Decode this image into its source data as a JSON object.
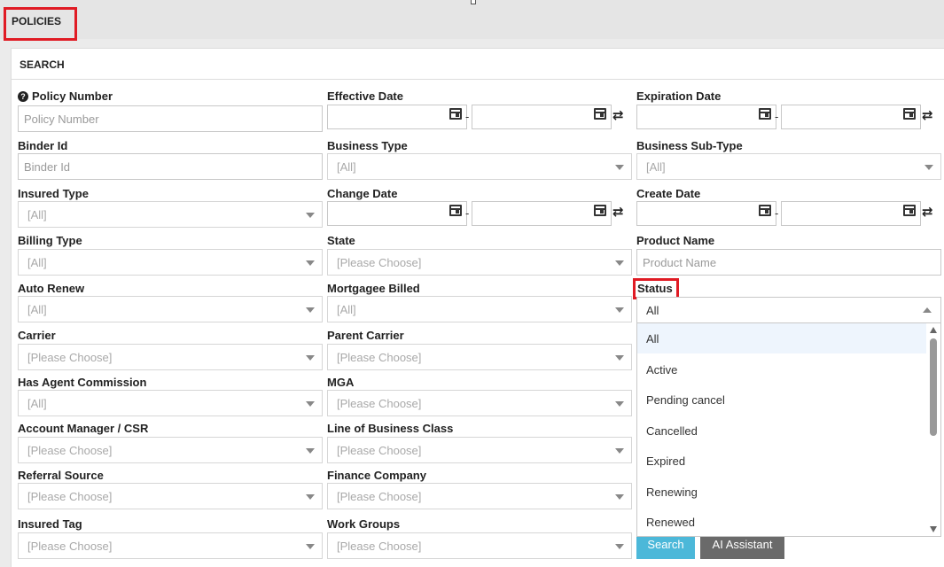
{
  "tab": {
    "title": "POLICIES"
  },
  "panel": {
    "header": "SEARCH"
  },
  "fields": {
    "policy_number": {
      "label": "Policy Number",
      "placeholder": "Policy Number"
    },
    "effective_date": {
      "label": "Effective Date"
    },
    "expiration_date": {
      "label": "Expiration Date"
    },
    "binder_id": {
      "label": "Binder Id",
      "placeholder": "Binder Id"
    },
    "business_type": {
      "label": "Business Type",
      "value": "[All]"
    },
    "business_sub_type": {
      "label": "Business Sub-Type",
      "value": "[All]"
    },
    "insured_type": {
      "label": "Insured Type",
      "value": "[All]"
    },
    "change_date": {
      "label": "Change Date"
    },
    "create_date": {
      "label": "Create Date"
    },
    "billing_type": {
      "label": "Billing Type",
      "value": "[All]"
    },
    "state": {
      "label": "State",
      "value": "[Please Choose]"
    },
    "product_name": {
      "label": "Product Name",
      "placeholder": "Product Name"
    },
    "auto_renew": {
      "label": "Auto Renew",
      "value": "[All]"
    },
    "mortgagee_billed": {
      "label": "Mortgagee Billed",
      "value": "[All]"
    },
    "status": {
      "label": "Status",
      "value": "All"
    },
    "carrier": {
      "label": "Carrier",
      "value": "[Please Choose]"
    },
    "parent_carrier": {
      "label": "Parent Carrier",
      "value": "[Please Choose]"
    },
    "has_agent_commission": {
      "label": "Has Agent Commission",
      "value": "[All]"
    },
    "mga": {
      "label": "MGA",
      "value": "[Please Choose]"
    },
    "account_manager": {
      "label": "Account Manager / CSR",
      "value": "[Please Choose]"
    },
    "line_of_business_class": {
      "label": "Line of Business Class",
      "value": "[Please Choose]"
    },
    "referral_source": {
      "label": "Referral Source",
      "value": "[Please Choose]"
    },
    "finance_company": {
      "label": "Finance Company",
      "value": "[Please Choose]"
    },
    "insured_tag": {
      "label": "Insured Tag",
      "value": "[Please Choose]"
    },
    "work_groups": {
      "label": "Work Groups",
      "value": "[Please Choose]"
    }
  },
  "range_separator": "-",
  "status_options": [
    "All",
    "Active",
    "Pending cancel",
    "Cancelled",
    "Expired",
    "Renewing",
    "Renewed"
  ],
  "buttons": {
    "search": "Search",
    "ai_assistant": "AI Assistant"
  },
  "colors": {
    "search_button": "#4cb8d9",
    "ai_button": "#6a6a6a",
    "highlight": "#e01b24"
  }
}
